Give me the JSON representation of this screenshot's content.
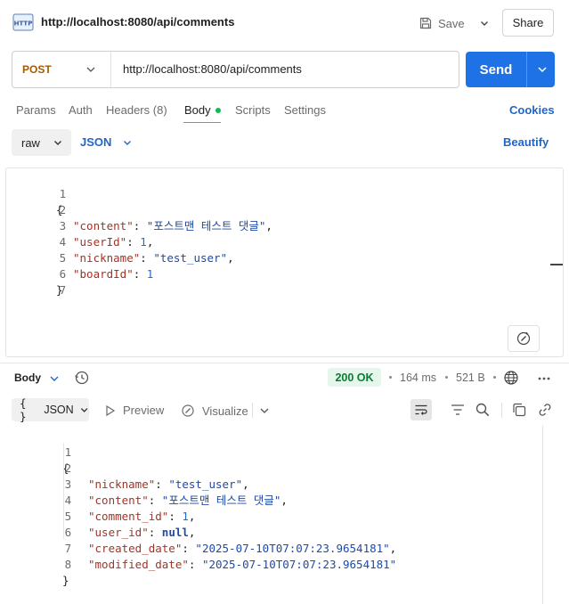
{
  "header": {
    "title": "http://localhost:8080/api/comments",
    "save_label": "Save",
    "share_label": "Share"
  },
  "request": {
    "method": "POST",
    "url": "http://localhost:8080/api/comments",
    "send_label": "Send"
  },
  "tabs": {
    "params": "Params",
    "auth": "Auth",
    "headers": "Headers",
    "headers_count": "(8)",
    "body": "Body",
    "scripts": "Scripts",
    "settings": "Settings",
    "active": "Body"
  },
  "cookies_label": "Cookies",
  "body_mode": {
    "type": "raw",
    "format": "JSON",
    "beautify_label": "Beautify"
  },
  "request_body": {
    "line_numbers": [
      "1",
      "2",
      "3",
      "4",
      "5",
      "6",
      "7"
    ],
    "open": "{",
    "lines": [
      {
        "key": "\"content\"",
        "sep": ": ",
        "value": "\"포스트맨 테스트 댓글\"",
        "tail": ",",
        "kind": "str"
      },
      {
        "key": "\"userId\"",
        "sep": ": ",
        "value": "1",
        "tail": ",",
        "kind": "num"
      },
      {
        "key": "\"nickname\"",
        "sep": ": ",
        "value": "\"test_user\"",
        "tail": ",",
        "kind": "str"
      },
      {
        "key": "\"boardId\"",
        "sep": ": ",
        "value": "1",
        "tail": "",
        "kind": "num"
      }
    ],
    "close": "}"
  },
  "response": {
    "body_label": "Body",
    "status": "200 OK",
    "time": "164 ms",
    "size": "521 B",
    "status_color": "#097c38"
  },
  "response_toolbar": {
    "format_braces": "{ }",
    "format": "JSON",
    "preview_label": "Preview",
    "visualize_label": "Visualize"
  },
  "response_body": {
    "line_numbers": [
      "1",
      "2",
      "3",
      "4",
      "5",
      "6",
      "7",
      "8"
    ],
    "open": "{",
    "lines": [
      {
        "key": "\"nickname\"",
        "sep": ": ",
        "value": "\"test_user\"",
        "tail": ",",
        "kind": "str"
      },
      {
        "key": "\"content\"",
        "sep": ": ",
        "value": "\"포스트맨 테스트 댓글\"",
        "tail": ",",
        "kind": "str"
      },
      {
        "key": "\"comment_id\"",
        "sep": ": ",
        "value": "1",
        "tail": ",",
        "kind": "num"
      },
      {
        "key": "\"user_id\"",
        "sep": ": ",
        "value": "null",
        "tail": ",",
        "kind": "null"
      },
      {
        "key": "\"created_date\"",
        "sep": ": ",
        "value": "\"2025-07-10T07:07:23.9654181\"",
        "tail": ",",
        "kind": "str"
      },
      {
        "key": "\"modified_date\"",
        "sep": ": ",
        "value": "\"2025-07-10T07:07:23.9654181\"",
        "tail": "",
        "kind": "str"
      }
    ],
    "close": "}"
  },
  "colors": {
    "accent": "#1f72e6",
    "method": "#a45a00",
    "tab_underline": "#f26b3a",
    "link": "#1f66cc"
  }
}
